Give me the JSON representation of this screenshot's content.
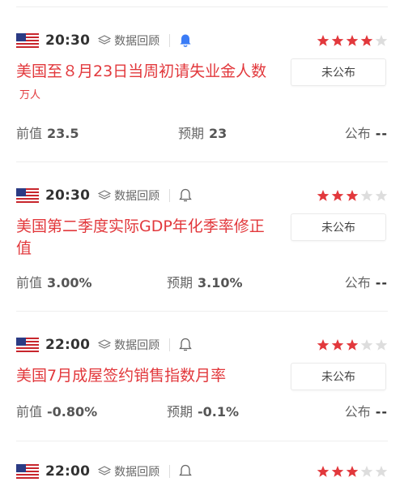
{
  "colors": {
    "accent": "#e2383c",
    "star_on": "#e2383c",
    "star_off": "#dddddd",
    "bell_active": "#3b7cf6"
  },
  "labels": {
    "review": "数据回顾",
    "prev": "前值",
    "forecast": "预期",
    "published": "公布"
  },
  "events": [
    {
      "time": "20:30",
      "flag": "us-flag",
      "bell_active": true,
      "stars": 4,
      "title": "美国至８月23日当周初请失业金人数",
      "unit": "万人",
      "status": "未公布",
      "prev": "23.5",
      "forecast": "23",
      "actual": "--"
    },
    {
      "time": "20:30",
      "flag": "us-flag",
      "bell_active": false,
      "stars": 3,
      "title": "美国第二季度实际GDP年化季率修正值",
      "unit": "",
      "status": "未公布",
      "prev": "3.00%",
      "forecast": "3.10%",
      "actual": "--"
    },
    {
      "time": "22:00",
      "flag": "us-flag",
      "bell_active": false,
      "stars": 3,
      "title": "美国7月成屋签约销售指数月率",
      "unit": "",
      "status": "未公布",
      "prev": "-0.80%",
      "forecast": "-0.1%",
      "actual": "--"
    },
    {
      "time": "22:00",
      "flag": "us-flag",
      "bell_active": false,
      "stars": 3
    }
  ]
}
